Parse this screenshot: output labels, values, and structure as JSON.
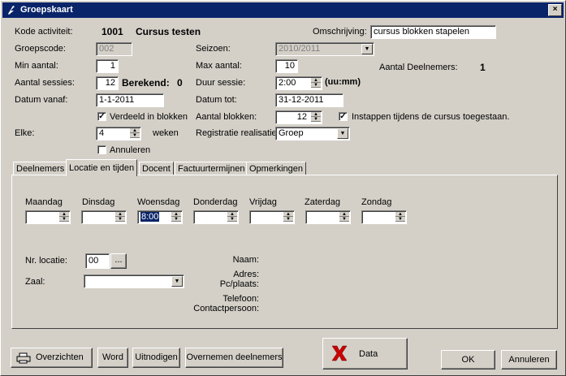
{
  "window": {
    "title": "Groepskaart",
    "close_symbol": "×"
  },
  "form": {
    "kode_activiteit": {
      "label": "Kode activiteit:",
      "code": "1001",
      "name": "Cursus testen"
    },
    "omschrijving": {
      "label": "Omschrijving:",
      "value": "cursus blokken stapelen"
    },
    "groepscode": {
      "label": "Groepscode:",
      "value": "002"
    },
    "seizoen": {
      "label": "Seizoen:",
      "value": "2010/2011"
    },
    "min_aantal": {
      "label": "Min aantal:",
      "value": "1"
    },
    "max_aantal": {
      "label": "Max aantal:",
      "value": "10"
    },
    "aantal_deelnemers": {
      "label": "Aantal Deelnemers:",
      "value": "1"
    },
    "aantal_sessies": {
      "label": "Aantal sessies:",
      "value": "12",
      "berekend_label": "Berekend:",
      "berekend_value": "0"
    },
    "duur_sessie": {
      "label": "Duur sessie:",
      "value": "2:00",
      "unit": "(uu:mm)"
    },
    "datum_vanaf": {
      "label": "Datum vanaf:",
      "value": "1-1-2011"
    },
    "datum_tot": {
      "label": "Datum tot:",
      "value": "31-12-2011"
    },
    "verdeeld": {
      "label": "Verdeeld in blokken",
      "checked": true
    },
    "aantal_blokken": {
      "label": "Aantal blokken:",
      "value": "12"
    },
    "instappen": {
      "label": "Instappen tijdens de cursus toegestaan.",
      "checked": true
    },
    "elke": {
      "label": "Elke:",
      "value": "4",
      "unit": "weken"
    },
    "registratie": {
      "label": "Registratie realisatie:",
      "value": "Groep"
    },
    "annuleren": {
      "label": "Annuleren",
      "checked": false
    }
  },
  "tabs": [
    "Deelnemers",
    "Locatie en tijden",
    "Docent",
    "Factuurtermijnen",
    "Opmerkingen"
  ],
  "days": [
    {
      "label": "Maandag",
      "value": ""
    },
    {
      "label": "Dinsdag",
      "value": ""
    },
    {
      "label": "Woensdag",
      "value": "8:00"
    },
    {
      "label": "Donderdag",
      "value": ""
    },
    {
      "label": "Vrijdag",
      "value": ""
    },
    {
      "label": "Zaterdag",
      "value": ""
    },
    {
      "label": "Zondag",
      "value": ""
    }
  ],
  "locatie": {
    "nr_label": "Nr. locatie:",
    "nr_value": "00",
    "browse": "...",
    "zaal_label": "Zaal:",
    "zaal_value": "",
    "naam": "Naam:",
    "adres": "Adres:",
    "pc": "Pc/plaats:",
    "telefoon": "Telefoon:",
    "contact": "Contactpersoon:"
  },
  "buttons": {
    "overzichten": "Overzichten",
    "word": "Word",
    "uitnodigen": "Uitnodigen",
    "overnemen": "Overnemen deelnemers",
    "data": "Data",
    "ok": "OK",
    "annuleren": "Annuleren"
  },
  "colors": {
    "titlebar": "#0a246a",
    "face": "#d4d0c8",
    "data_x": "#cc0000"
  }
}
